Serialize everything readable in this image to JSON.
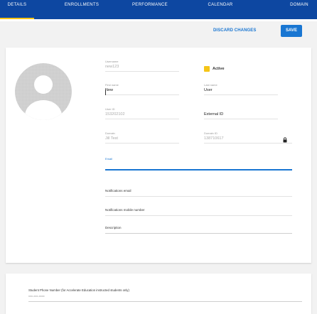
{
  "tabs": [
    {
      "label": "DETAILS",
      "active": true
    },
    {
      "label": "ENROLLMENTS",
      "active": false
    },
    {
      "label": "PERFORMANCE",
      "active": false
    },
    {
      "label": "CALENDAR",
      "active": false
    },
    {
      "label": "DOMAIN",
      "active": false
    }
  ],
  "actions": {
    "discard_label": "DISCARD CHANGES",
    "save_label": "SAVE"
  },
  "fields": {
    "username": {
      "label": "Username",
      "value": "new123"
    },
    "active": {
      "label": "Active",
      "checked": true
    },
    "first_name": {
      "label": "First name",
      "value": "New"
    },
    "last_name": {
      "label": "Last name",
      "value": "User"
    },
    "user_id": {
      "label": "User ID",
      "value": "153202102"
    },
    "external_id": {
      "label": "External ID"
    },
    "domain": {
      "label": "Domain",
      "value": "Jill Test"
    },
    "domain_id": {
      "label": "Domain ID",
      "value": "138710617"
    },
    "email": {
      "label": "Email"
    },
    "notifications_email": {
      "label": "Notifications email"
    },
    "notifications_mobile": {
      "label": "Notifications mobile number"
    },
    "description": {
      "label": "Description"
    }
  },
  "student_phone": {
    "label": "Student Phone Number (for Accelerate Education instructed students only)",
    "value": "xxx-xxx-xxxx"
  },
  "colors": {
    "primary": "#1976d2",
    "header": "#0d47a1",
    "accent": "#f5c518"
  }
}
